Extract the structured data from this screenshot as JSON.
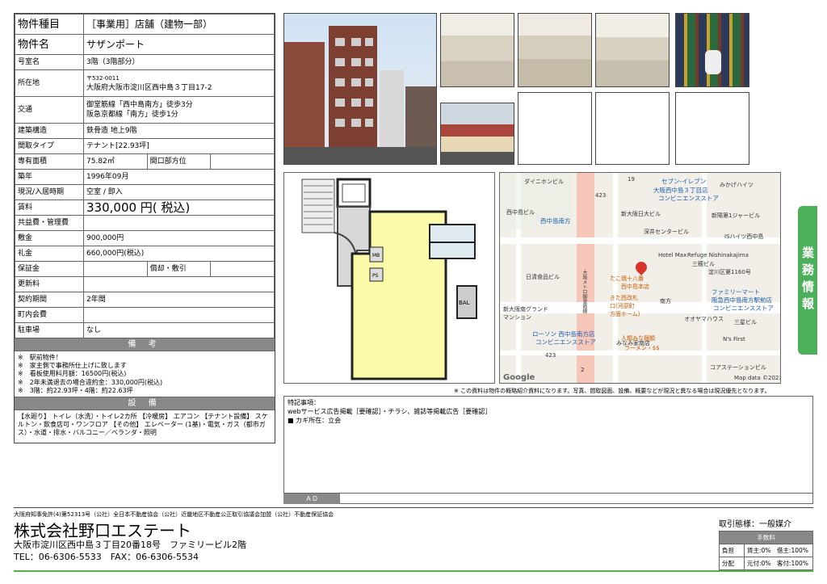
{
  "property": {
    "rows": [
      {
        "key": "物件種目",
        "value": "［事業用］店舗（建物一部）",
        "style": "big"
      },
      {
        "key": "物件名",
        "value": "サザンポート",
        "style": "big"
      },
      {
        "key": "号室名",
        "value": "3階（3階部分）"
      },
      {
        "key": "所在地",
        "value": "〒532-0011",
        "value2": "大阪府大阪市淀川区西中島３丁目17-2",
        "style": "tall"
      },
      {
        "key": "交通",
        "value": "御堂筋線「西中島南方」徒歩3分",
        "value2": "阪急京都線「南方」徒歩1分",
        "style": "tall"
      },
      {
        "key": "建築構造",
        "value": "鉄骨造 地上9階"
      },
      {
        "key": "間取タイプ",
        "value": "テナント[22.93坪]"
      },
      {
        "key": "専有面積",
        "value": "75.82㎡",
        "key2": "開口部方位",
        "value3": ""
      },
      {
        "key": "築年",
        "value": "1996年09月"
      },
      {
        "key": "現況/入居時期",
        "value": "空室 / 即入"
      },
      {
        "key": "賃料",
        "value": "330,000 円( 税込)",
        "style": "rent"
      },
      {
        "key": "共益費・管理費",
        "value": ""
      },
      {
        "key": "敷金",
        "value": "900,000円"
      },
      {
        "key": "礼金",
        "value": "660,000円(税込)"
      },
      {
        "key": "保証金",
        "value": "",
        "key2": "償却・敷引",
        "value3": ""
      },
      {
        "key": "更新料",
        "value": ""
      },
      {
        "key": "契約期間",
        "value": "2年間"
      },
      {
        "key": "町内会費",
        "value": ""
      },
      {
        "key": "駐車場",
        "value": "なし"
      }
    ],
    "remarks_title": "備 考",
    "remarks": [
      "※　駅前物件！",
      "※　家主側で事務所仕上げに致します",
      "※　看板使用料月額：16500円(税込)",
      "※　2年未満退去の場合違約金：330,000円(税込)",
      "※　3階：約22.93坪・4階：約22.63坪"
    ],
    "facilities_title": "設 備",
    "facilities": "【水廻り】 トイレ（水洗）・トイレ2カ所 【冷暖房】 エアコン 【テナント設備】 スケルトン・飲食店可・ワンフロア 【その他】 エレベーター (1基)・電気・ガス（都市ガス）・水道・排水・バルコニー／ベランダ・照明"
  },
  "floorplan": {
    "labels": [
      "MB",
      "PS",
      "BAL"
    ]
  },
  "map": {
    "labels": [
      {
        "t": "ダイニホンビル"
      },
      {
        "t": "19"
      },
      {
        "t": "セブン-イレブン",
        "c": "blue"
      },
      {
        "t": "みかげハイツ"
      },
      {
        "t": "大阪西中島３丁目店",
        "c": "blue"
      },
      {
        "t": "コンビニエンスストア",
        "c": "blue"
      },
      {
        "t": "西中島ビル"
      },
      {
        "t": "西中島南方",
        "c": "blue"
      },
      {
        "t": "新大阪日大ビル"
      },
      {
        "t": "新陽第1ジャービル"
      },
      {
        "t": "423"
      },
      {
        "t": "深井センタービル"
      },
      {
        "t": "ISハイツ西中島"
      },
      {
        "t": "Hotel Max"
      },
      {
        "t": "Refuge Nishinakajima"
      },
      {
        "t": "三穂ビル"
      },
      {
        "t": "淀川区第1160号"
      },
      {
        "t": "日清食品ビル"
      },
      {
        "t": "たこ焼十八番",
        "c": "orange"
      },
      {
        "t": "西中島本店",
        "c": "orange"
      },
      {
        "t": "ファミリーマート",
        "c": "blue"
      },
      {
        "t": "阪急西中島南方駅前店",
        "c": "blue"
      },
      {
        "t": "コンビニエンスストア",
        "c": "blue"
      },
      {
        "t": "きた西改札",
        "c": "orange"
      },
      {
        "t": "口(河原町",
        "c": "orange"
      },
      {
        "t": "方面ホーム)",
        "c": "orange"
      },
      {
        "t": "南方"
      },
      {
        "t": "新大阪南グランド"
      },
      {
        "t": "マンション"
      },
      {
        "t": "オオヤマハウス"
      },
      {
        "t": "三星ビル"
      },
      {
        "t": "ローソン 西中島南方店",
        "c": "blue"
      },
      {
        "t": "コンビニエンスストア",
        "c": "blue"
      },
      {
        "t": "みなみ家南店"
      },
      {
        "t": "人類みな麺類",
        "c": "orange"
      },
      {
        "t": "ラーメン・$$",
        "c": "orange"
      },
      {
        "t": "N's First"
      },
      {
        "t": "コアステーションビル"
      },
      {
        "t": "423"
      },
      {
        "t": "2"
      },
      {
        "t": "Google"
      },
      {
        "t": "Map data ©2023"
      },
      {
        "t": "大阪メトロ御堂筋線"
      }
    ]
  },
  "disclaimer": "※ この資料は物件の概略紹介資料になります。写真、間取図面、設備、概要などが現況と異なる場合は現況優先となります。",
  "notes": {
    "title": "特記事項：",
    "lines": [
      "webサービス広告掲載［要確認］・チラシ、雑誌等掲載広告［要確認］",
      "■ カギ所在：立会"
    ],
    "ad_label": "ＡＤ"
  },
  "side_tab": "業務情報",
  "footer": {
    "legal": "大阪府知事免許(4)第52313号（公社）全日本不動産協会（公社）近畿地区不動産公正取引協議会加盟（公社）不動産保証協会",
    "company": "株式会社野口エステート",
    "address": "大阪市淀川区西中島３丁目20番18号　ファミリービル2階",
    "tel": "TEL：06-6306-5533　FAX：06-6306-5534",
    "deal_label": "取引態様：一般媒介",
    "fee_header": "手数料",
    "fee_rows": [
      {
        "k": "負担",
        "v": "賃主:0%　借主:100%"
      },
      {
        "k": "分配",
        "v": "元付:0%　客付:100%"
      }
    ]
  }
}
